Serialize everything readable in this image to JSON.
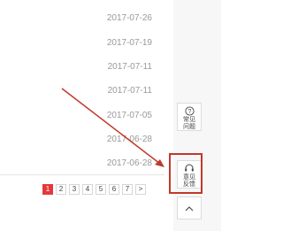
{
  "list": {
    "dates": [
      "2017-07-26",
      "2017-07-19",
      "2017-07-11",
      "2017-07-11",
      "2017-07-05",
      "2017-06-28",
      "2017-06-28"
    ]
  },
  "pagination": {
    "pages": [
      "1",
      "2",
      "3",
      "4",
      "5",
      "6",
      "7"
    ],
    "next": ">",
    "current": "1"
  },
  "side_toolbar": {
    "faq_icon": "?",
    "faq_label_1": "常见",
    "faq_label_2": "问题",
    "feedback_label_1": "意见",
    "feedback_label_2": "反馈",
    "top_icon": "chevron-up-icon"
  },
  "colors": {
    "accent": "#e4393c",
    "annotation": "#c0392b",
    "date_text": "#999999"
  }
}
